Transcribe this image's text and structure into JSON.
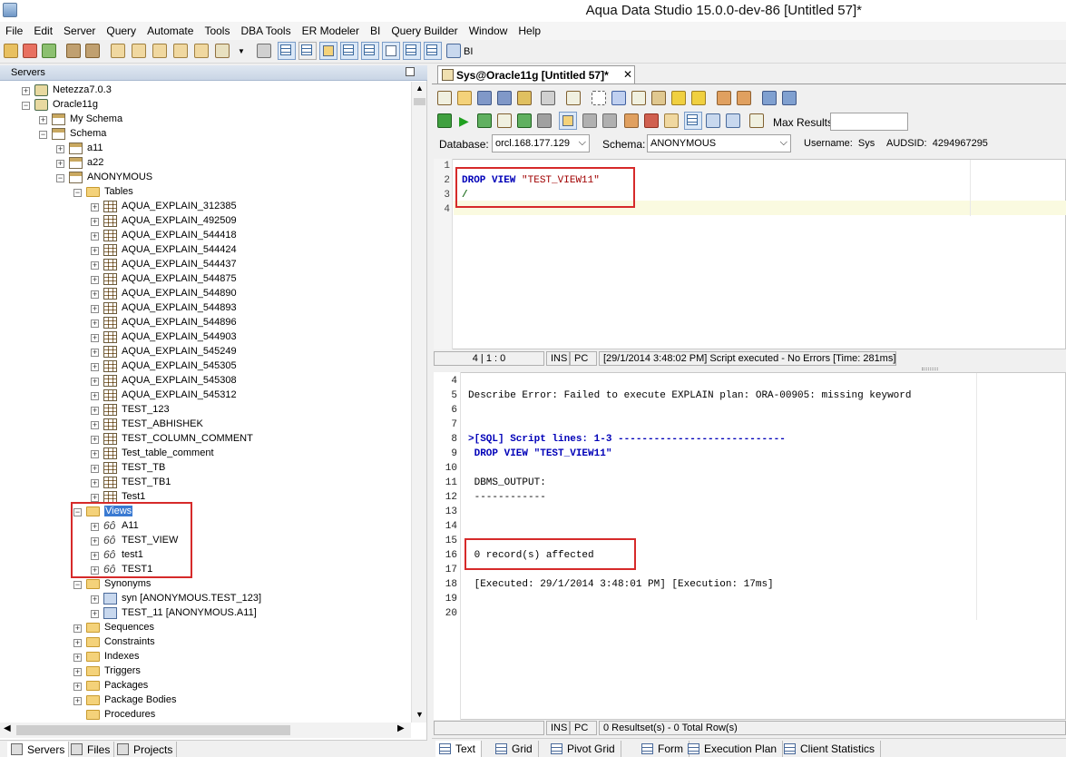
{
  "window": {
    "title": "Aqua Data Studio 15.0.0-dev-86 [Untitled 57]*"
  },
  "menu": [
    "File",
    "Edit",
    "Server",
    "Query",
    "Automate",
    "Tools",
    "DBA Tools",
    "ER Modeler",
    "BI",
    "Query Builder",
    "Window",
    "Help"
  ],
  "toolbar": {
    "bi_label": "BI"
  },
  "servers_panel": {
    "title": "Servers",
    "tree": [
      {
        "label": "Netezza7.0.3",
        "level": 1,
        "icon": "server-icon",
        "expander": "+"
      },
      {
        "label": "Oracle11g",
        "level": 1,
        "icon": "server-icon",
        "expander": "-"
      },
      {
        "label": "My Schema",
        "level": 2,
        "icon": "schema-icon",
        "expander": "+"
      },
      {
        "label": "Schema",
        "level": 2,
        "icon": "schema-icon",
        "expander": "-"
      },
      {
        "label": "a11",
        "level": 3,
        "icon": "schema-icon",
        "expander": "+"
      },
      {
        "label": "a22",
        "level": 3,
        "icon": "schema-icon",
        "expander": "+"
      },
      {
        "label": "ANONYMOUS",
        "level": 3,
        "icon": "schema-icon",
        "expander": "-"
      },
      {
        "label": "Tables",
        "level": 4,
        "icon": "folder-icon",
        "expander": "-"
      },
      {
        "label": "AQUA_EXPLAIN_312385",
        "level": 5,
        "icon": "table-icon",
        "expander": "+"
      },
      {
        "label": "AQUA_EXPLAIN_492509",
        "level": 5,
        "icon": "table-icon",
        "expander": "+"
      },
      {
        "label": "AQUA_EXPLAIN_544418",
        "level": 5,
        "icon": "table-icon",
        "expander": "+"
      },
      {
        "label": "AQUA_EXPLAIN_544424",
        "level": 5,
        "icon": "table-icon",
        "expander": "+"
      },
      {
        "label": "AQUA_EXPLAIN_544437",
        "level": 5,
        "icon": "table-icon",
        "expander": "+"
      },
      {
        "label": "AQUA_EXPLAIN_544875",
        "level": 5,
        "icon": "table-icon",
        "expander": "+"
      },
      {
        "label": "AQUA_EXPLAIN_544890",
        "level": 5,
        "icon": "table-icon",
        "expander": "+"
      },
      {
        "label": "AQUA_EXPLAIN_544893",
        "level": 5,
        "icon": "table-icon",
        "expander": "+"
      },
      {
        "label": "AQUA_EXPLAIN_544896",
        "level": 5,
        "icon": "table-icon",
        "expander": "+"
      },
      {
        "label": "AQUA_EXPLAIN_544903",
        "level": 5,
        "icon": "table-icon",
        "expander": "+"
      },
      {
        "label": "AQUA_EXPLAIN_545249",
        "level": 5,
        "icon": "table-icon",
        "expander": "+"
      },
      {
        "label": "AQUA_EXPLAIN_545305",
        "level": 5,
        "icon": "table-icon",
        "expander": "+"
      },
      {
        "label": "AQUA_EXPLAIN_545308",
        "level": 5,
        "icon": "table-icon",
        "expander": "+"
      },
      {
        "label": "AQUA_EXPLAIN_545312",
        "level": 5,
        "icon": "table-icon",
        "expander": "+"
      },
      {
        "label": "TEST_123",
        "level": 5,
        "icon": "table-icon",
        "expander": "+"
      },
      {
        "label": "TEST_ABHISHEK",
        "level": 5,
        "icon": "table-icon",
        "expander": "+"
      },
      {
        "label": "TEST_COLUMN_COMMENT",
        "level": 5,
        "icon": "table-icon",
        "expander": "+"
      },
      {
        "label": "Test_table_comment",
        "level": 5,
        "icon": "table-icon",
        "expander": "+"
      },
      {
        "label": "TEST_TB",
        "level": 5,
        "icon": "table-icon",
        "expander": "+"
      },
      {
        "label": "TEST_TB1",
        "level": 5,
        "icon": "table-icon",
        "expander": "+"
      },
      {
        "label": "Test1",
        "level": 5,
        "icon": "table-icon",
        "expander": "+"
      },
      {
        "label": "Views",
        "level": 4,
        "icon": "folder-icon",
        "expander": "-",
        "selected": true
      },
      {
        "label": "A11",
        "level": 5,
        "icon": "view-icon",
        "expander": "+"
      },
      {
        "label": "TEST_VIEW",
        "level": 5,
        "icon": "view-icon",
        "expander": "+"
      },
      {
        "label": "test1",
        "level": 5,
        "icon": "view-icon",
        "expander": "+"
      },
      {
        "label": "TEST1",
        "level": 5,
        "icon": "view-icon",
        "expander": "+"
      },
      {
        "label": "Synonyms",
        "level": 4,
        "icon": "folder-icon",
        "expander": "-"
      },
      {
        "label": "syn [ANONYMOUS.TEST_123]",
        "level": 5,
        "icon": "synonym-icon",
        "expander": "+"
      },
      {
        "label": "TEST_11 [ANONYMOUS.A11]",
        "level": 5,
        "icon": "synonym-icon",
        "expander": "+"
      },
      {
        "label": "Sequences",
        "level": 4,
        "icon": "folder-icon",
        "expander": "+"
      },
      {
        "label": "Constraints",
        "level": 4,
        "icon": "folder-icon",
        "expander": "+"
      },
      {
        "label": "Indexes",
        "level": 4,
        "icon": "folder-icon",
        "expander": "+"
      },
      {
        "label": "Triggers",
        "level": 4,
        "icon": "folder-icon",
        "expander": "+"
      },
      {
        "label": "Packages",
        "level": 4,
        "icon": "folder-icon",
        "expander": "+"
      },
      {
        "label": "Package Bodies",
        "level": 4,
        "icon": "folder-icon",
        "expander": "+"
      },
      {
        "label": "Procedures",
        "level": 4,
        "icon": "folder-icon",
        "expander": ""
      }
    ],
    "bottom_tabs": [
      "Servers",
      "Files",
      "Projects"
    ]
  },
  "query_window": {
    "tab_label": "Sys@Oracle11g [Untitled 57]*",
    "max_results_label": "Max Results:",
    "max_results_value": "",
    "database_label": "Database:",
    "database_value": "orcl.168.177.129",
    "schema_label": "Schema:",
    "schema_value": "ANONYMOUS",
    "username_label": "Username:",
    "username_value": "Sys",
    "audsid_label": "AUDSID:",
    "audsid_value": "4294967295",
    "editor_lines": [
      "1",
      "2",
      "3",
      "4"
    ],
    "editor_code": {
      "drop_kw": "DROP VIEW",
      "view_name": "\"TEST_VIEW11\"",
      "slash": "/"
    },
    "editor_status": {
      "position": "4 | 1 : 0",
      "mode": "INS",
      "pc": "PC",
      "message": "[29/1/2014 3:48:02 PM] Script executed - No Errors [Time: 281ms]"
    },
    "output_lines": [
      {
        "n": "4",
        "text": ""
      },
      {
        "n": "5",
        "text": "Describe Error: Failed to execute EXPLAIN plan: ORA-00905: missing keyword"
      },
      {
        "n": "6",
        "text": ""
      },
      {
        "n": "7",
        "text": ""
      },
      {
        "n": "8",
        "text": ">[SQL] Script lines: 1-3 ----------------------------"
      },
      {
        "n": "9",
        "text": " DROP VIEW \"TEST_VIEW11\""
      },
      {
        "n": "10",
        "text": ""
      },
      {
        "n": "11",
        "text": " DBMS_OUTPUT:"
      },
      {
        "n": "12",
        "text": " ------------"
      },
      {
        "n": "13",
        "text": ""
      },
      {
        "n": "14",
        "text": ""
      },
      {
        "n": "15",
        "text": ""
      },
      {
        "n": "16",
        "text": " 0 record(s) affected"
      },
      {
        "n": "17",
        "text": ""
      },
      {
        "n": "18",
        "text": " [Executed: 29/1/2014 3:48:01 PM] [Execution: 17ms]"
      },
      {
        "n": "19",
        "text": ""
      },
      {
        "n": "20",
        "text": ""
      }
    ],
    "output_status": {
      "mode": "INS",
      "pc": "PC",
      "message": "0 Resultset(s) - 0 Total Row(s)"
    },
    "bottom_tabs": [
      "Text",
      "Grid",
      "Pivot Grid",
      "Form",
      "Execution Plan",
      "Client Statistics"
    ]
  },
  "colors": {
    "highlight": "#d62a2a",
    "keyword": "#0000b8",
    "string": "#a00000",
    "selection": "#3a7ad2"
  }
}
